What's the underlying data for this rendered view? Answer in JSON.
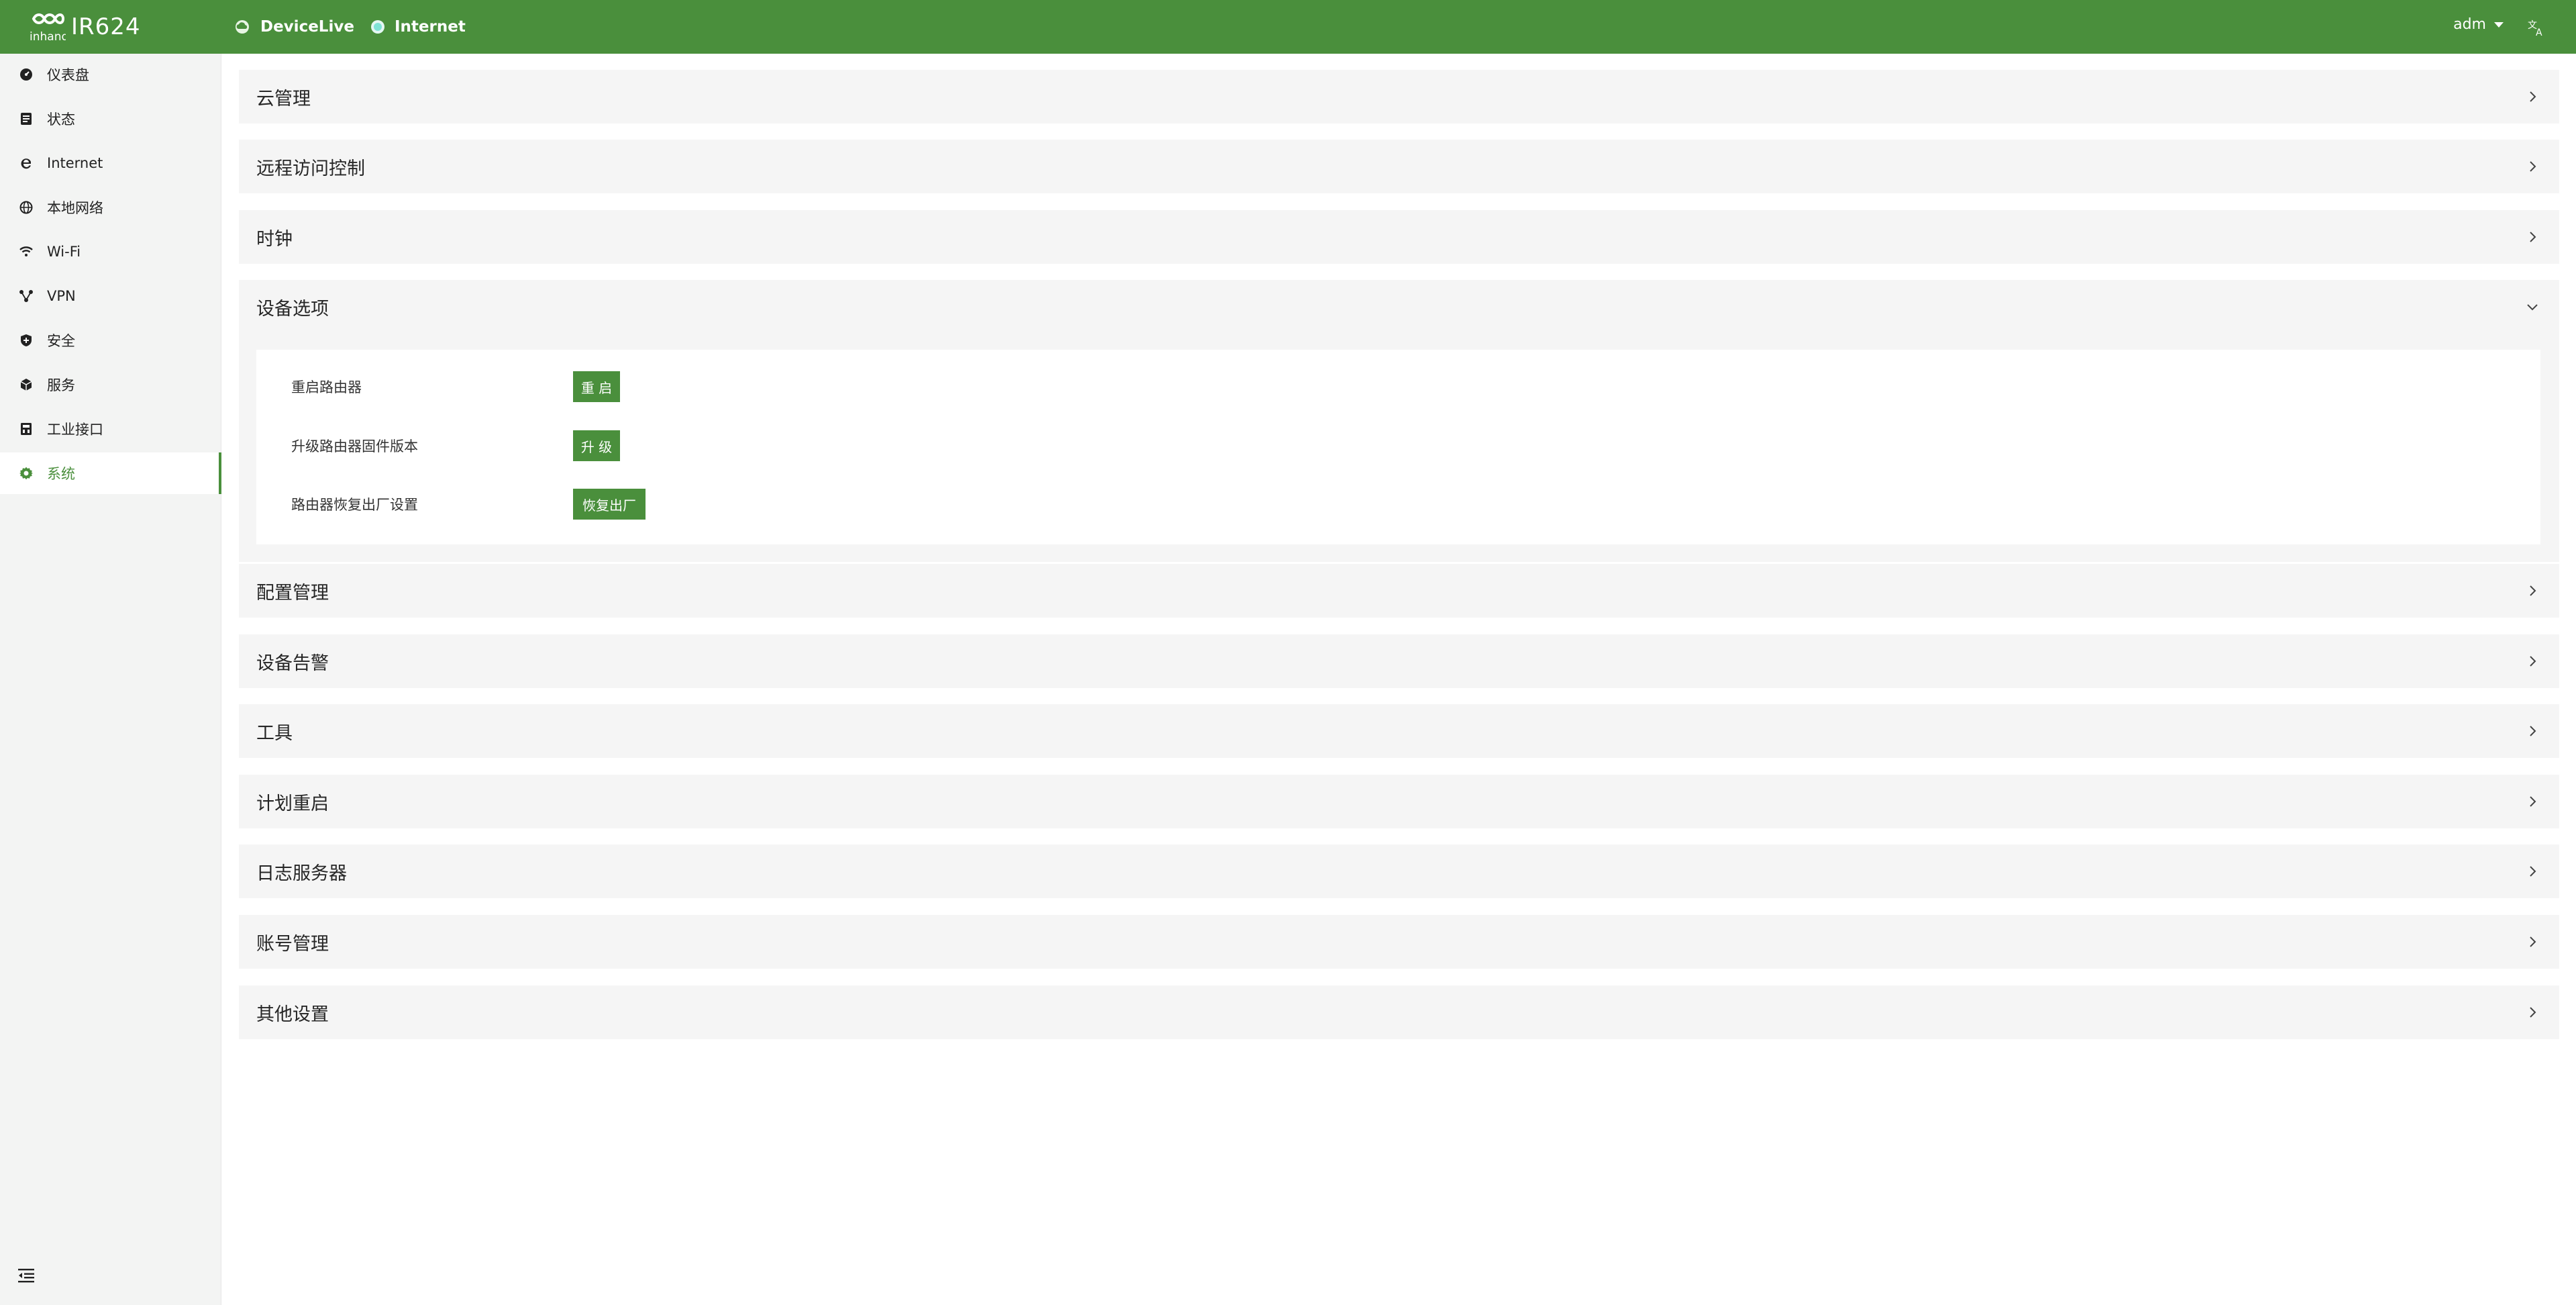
{
  "header": {
    "brand_small": "inhand",
    "product_name": "IR624",
    "status_items": [
      {
        "label": "DeviceLive",
        "icon": "cloud-icon"
      },
      {
        "label": "Internet",
        "icon": "status-dot-icon"
      }
    ],
    "user": "adm",
    "language_icon": "translate-icon"
  },
  "sidebar": {
    "items": [
      {
        "label": "仪表盘",
        "icon": "dashboard-icon"
      },
      {
        "label": "状态",
        "icon": "status-list-icon"
      },
      {
        "label": "Internet",
        "icon": "internet-explorer-icon"
      },
      {
        "label": "本地网络",
        "icon": "globe-icon"
      },
      {
        "label": "Wi-Fi",
        "icon": "wifi-icon"
      },
      {
        "label": "VPN",
        "icon": "vpn-nodes-icon"
      },
      {
        "label": "安全",
        "icon": "shield-icon"
      },
      {
        "label": "服务",
        "icon": "cube-icon"
      },
      {
        "label": "工业接口",
        "icon": "industrial-port-icon"
      },
      {
        "label": "系统",
        "icon": "gear-icon",
        "active": true
      }
    ],
    "collapse_icon": "menu-fold-icon"
  },
  "panels": [
    {
      "title": "云管理",
      "expanded": false
    },
    {
      "title": "远程访问控制",
      "expanded": false
    },
    {
      "title": "时钟",
      "expanded": false
    },
    {
      "title": "设备选项",
      "expanded": true
    },
    {
      "title": "配置管理",
      "expanded": false
    },
    {
      "title": "设备告警",
      "expanded": false
    },
    {
      "title": "工具",
      "expanded": false
    },
    {
      "title": "计划重启",
      "expanded": false
    },
    {
      "title": "日志服务器",
      "expanded": false
    },
    {
      "title": "账号管理",
      "expanded": false
    },
    {
      "title": "其他设置",
      "expanded": false
    }
  ],
  "device_options": [
    {
      "label": "重启路由器",
      "button": "重 启"
    },
    {
      "label": "升级路由器固件版本",
      "button": "升 级"
    },
    {
      "label": "路由器恢复出厂设置",
      "button": "恢复出厂"
    }
  ],
  "colors": {
    "primary": "#4a8f3c",
    "panel_bg": "#f5f5f5",
    "sidebar_bg": "#f3f4f3",
    "internet_dot": "#7fe3d6"
  }
}
